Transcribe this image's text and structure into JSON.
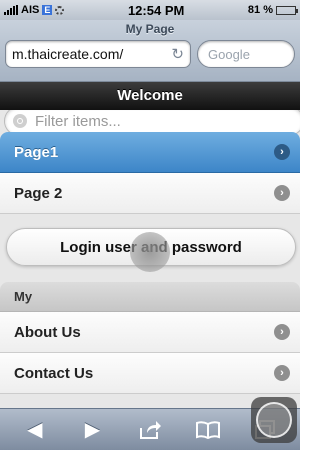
{
  "status_bar": {
    "carrier": "AIS",
    "network": "E",
    "time": "12:54 PM",
    "battery": "81 %",
    "battery_level": 0.81
  },
  "browser": {
    "page_title": "My Page",
    "url": "m.thaicreate.com/",
    "search_placeholder": "Google"
  },
  "header": {
    "title": "Welcome"
  },
  "filter": {
    "placeholder": "Filter items..."
  },
  "list": {
    "items": [
      {
        "label": "Page1",
        "active": true
      },
      {
        "label": "Page 2",
        "active": false
      }
    ]
  },
  "login_button": {
    "label": "Login user and password"
  },
  "section": {
    "divider": "My",
    "items": [
      {
        "label": "About Us"
      },
      {
        "label": "Contact Us"
      }
    ]
  },
  "toolbar": {
    "icons": [
      "back-icon",
      "forward-icon",
      "share-icon",
      "bookmarks-icon",
      "tabs-icon"
    ]
  },
  "colors": {
    "accent": "#3d86c8",
    "header_bg": "#111111",
    "toolbar_bg": "#7e8ca0"
  }
}
